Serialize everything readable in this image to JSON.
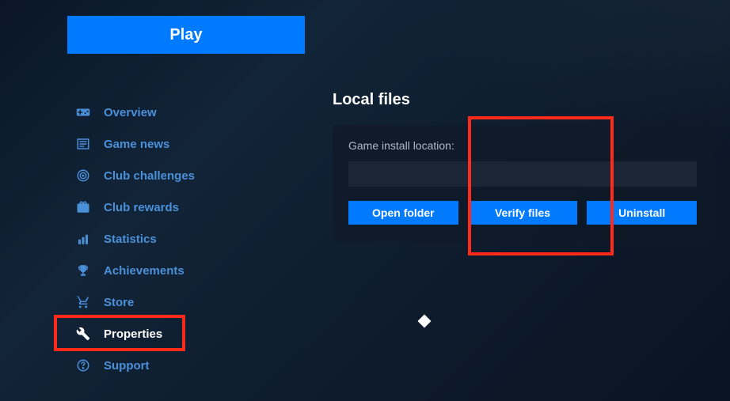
{
  "play_button": "Play",
  "sidebar": {
    "items": [
      {
        "label": "Overview"
      },
      {
        "label": "Game news"
      },
      {
        "label": "Club challenges"
      },
      {
        "label": "Club rewards"
      },
      {
        "label": "Statistics"
      },
      {
        "label": "Achievements"
      },
      {
        "label": "Store"
      },
      {
        "label": "Properties"
      },
      {
        "label": "Support"
      }
    ]
  },
  "main": {
    "section_title": "Local files",
    "install_label": "Game install location:",
    "install_path": "",
    "buttons": {
      "open_folder": "Open folder",
      "verify_files": "Verify files",
      "uninstall": "Uninstall"
    }
  }
}
